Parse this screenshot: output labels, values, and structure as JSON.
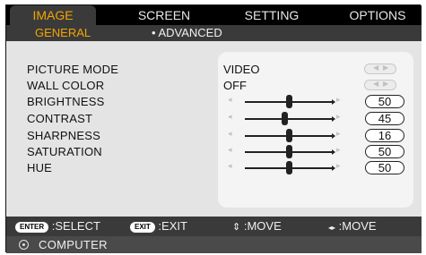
{
  "tabs": [
    {
      "label": "IMAGE",
      "active": true
    },
    {
      "label": "SCREEN",
      "active": false
    },
    {
      "label": "SETTING",
      "active": false
    },
    {
      "label": "OPTIONS",
      "active": false
    }
  ],
  "subtabs": [
    {
      "label": "GENERAL",
      "active": true
    },
    {
      "label": "• ADVANCED",
      "active": false
    }
  ],
  "rows": [
    {
      "label": "PICTURE MODE",
      "value": "VIDEO",
      "control": "selector"
    },
    {
      "label": "WALL COLOR",
      "value": "OFF",
      "control": "selector"
    },
    {
      "label": "BRIGHTNESS",
      "value": "50",
      "control": "slider",
      "level": 50
    },
    {
      "label": "CONTRAST",
      "value": "45",
      "control": "slider",
      "level": 45
    },
    {
      "label": "SHARPNESS",
      "value": "16",
      "control": "slider",
      "level": 50
    },
    {
      "label": "SATURATION",
      "value": "50",
      "control": "slider",
      "level": 50
    },
    {
      "label": "HUE",
      "value": "50",
      "control": "slider",
      "level": 50
    }
  ],
  "hints": [
    {
      "key": "ENTER",
      "text": ":SELECT"
    },
    {
      "key": "EXIT",
      "text": ":EXIT"
    },
    {
      "icon": "updown-arrows-icon",
      "glyph": "⇕",
      "text": ":MOVE"
    },
    {
      "icon": "leftright-arrows-icon",
      "glyph": "◂▸",
      "text": ":MOVE"
    }
  ],
  "source": {
    "icon": "source-icon",
    "label": "COMPUTER"
  },
  "colors": {
    "accent": "#f5a400",
    "bar": "#3a3a3a",
    "content": "#e4e4e4"
  }
}
